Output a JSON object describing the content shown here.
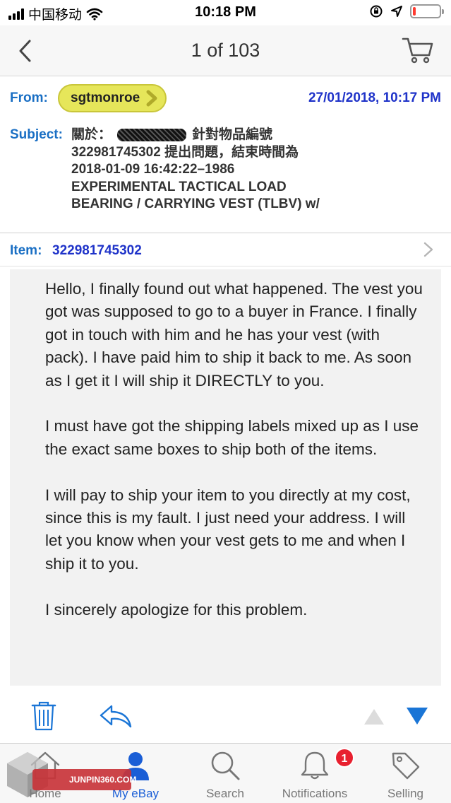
{
  "status_bar": {
    "carrier": "中国移动",
    "time": "10:18 PM",
    "battery_level": 0.1
  },
  "nav": {
    "title": "1 of 103",
    "back_icon": "chevron-left-icon",
    "cart_icon": "cart-icon"
  },
  "message_header": {
    "from_label": "From:",
    "sender": "sgtmonroe",
    "date": "27/01/2018, 10:17 PM",
    "subject_label": "Subject:",
    "subject_prefix": "關於：",
    "subject_suffix": "針對物品編號",
    "subject_lines": [
      "322981745302 提出問題，結束時間為",
      "2018-01-09 16:42:22–1986",
      "EXPERIMENTAL TACTICAL LOAD",
      "BEARING / CARRYING VEST (TLBV) w/"
    ],
    "item_label": "Item:",
    "item_number": "322981745302"
  },
  "message_body": {
    "paragraphs": [
      "Hello, I finally found out what happened. The vest you got was supposed to go to a buyer in France. I finally got in touch with him and he has your vest (with pack). I have paid him to ship it back to me. As soon as I get it I will ship it DIRECTLY to you.",
      "I must have got the shipping labels mixed up as I use the exact same boxes to ship both of the items.",
      "I will pay to ship your item to you directly at my cost, since this is my fault. I just need your address. I will let you know when your vest gets to me and when I ship it to you.",
      "I sincerely apologize for this problem."
    ]
  },
  "tabs": [
    {
      "label": "Home",
      "icon": "home-icon"
    },
    {
      "label": "My eBay",
      "icon": "person-icon"
    },
    {
      "label": "Search",
      "icon": "search-icon"
    },
    {
      "label": "Notifications",
      "icon": "bell-icon",
      "badge": "1"
    },
    {
      "label": "Selling",
      "icon": "tag-icon"
    }
  ],
  "watermark": {
    "text": "JUNPIN360.COM"
  },
  "colors": {
    "link_blue": "#1a6fc4",
    "date_blue": "#1f33c9",
    "pill_yellow": "#e6e65a",
    "action_blue": "#1a75d6",
    "badge_red": "#e8202f"
  }
}
